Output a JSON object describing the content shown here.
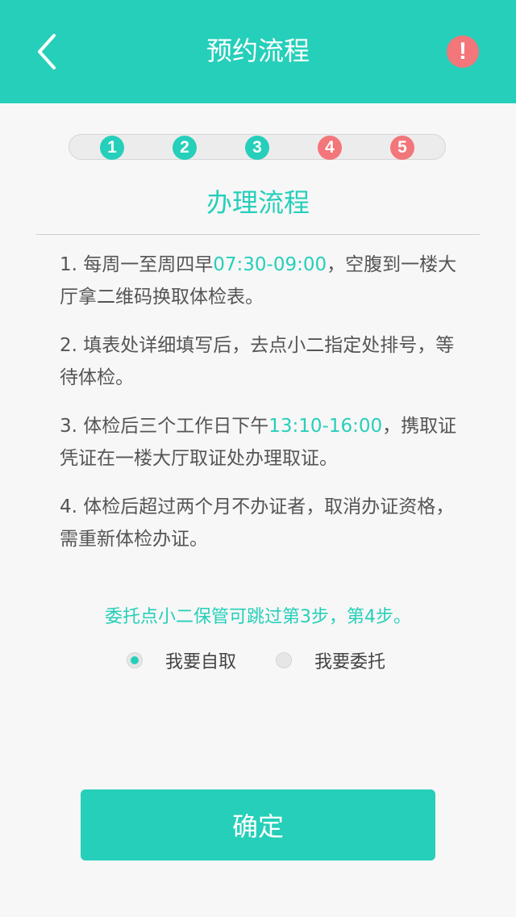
{
  "header": {
    "title": "预约流程",
    "back_icon": "chevron-left-icon",
    "alert_icon": "exclamation-icon",
    "alert_glyph": "!"
  },
  "stepper": [
    {
      "label": "1",
      "state": "done"
    },
    {
      "label": "2",
      "state": "done"
    },
    {
      "label": "3",
      "state": "done"
    },
    {
      "label": "4",
      "state": "todo"
    },
    {
      "label": "5",
      "state": "todo"
    }
  ],
  "section": {
    "title": "办理流程"
  },
  "procedure": {
    "item1": {
      "pre": "1. 每周一至周四早",
      "time": "07:30-09:00",
      "post": "，空腹到一楼大厅拿二维码换取体检表。"
    },
    "item2": {
      "text": "2. 填表处详细填写后，去点小二指定处排号，等待体检。"
    },
    "item3": {
      "pre": "3. 体检后三个工作日下午",
      "time": "13:10-16:00",
      "post": "，携取证凭证在一楼大厅取证处办理取证。"
    },
    "item4": {
      "text": "4. 体检后超过两个月不办证者，取消办证资格，需重新体检办证。"
    }
  },
  "note": "委托点小二保管可跳过第3步，第4步。",
  "options": {
    "self_pickup": "我要自取",
    "entrust": "我要委托",
    "selected": "self_pickup"
  },
  "confirm_label": "确定",
  "colors": {
    "accent": "#26cfba",
    "alert": "#f2767a",
    "background": "#f7f7f7"
  }
}
